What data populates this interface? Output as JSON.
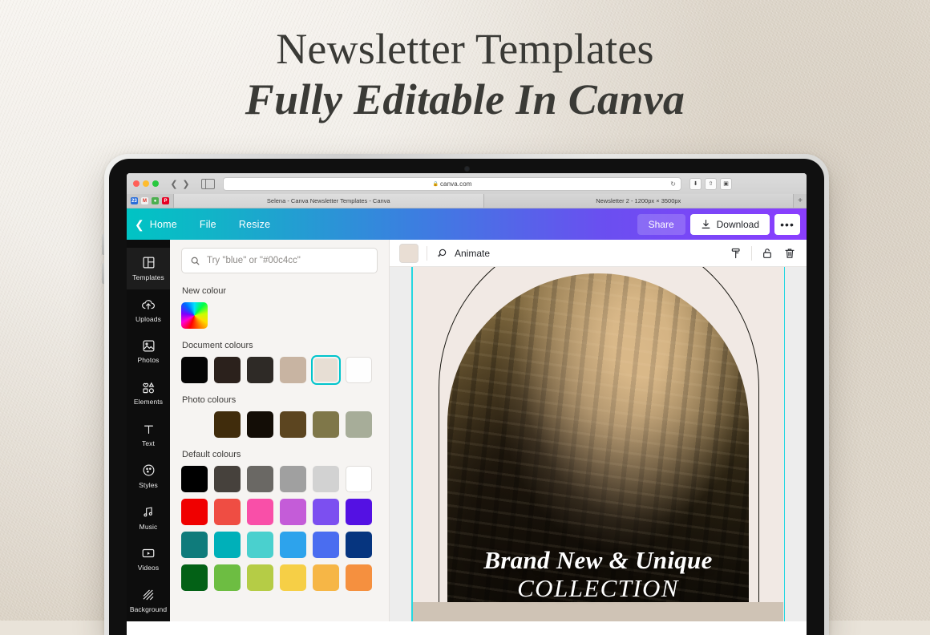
{
  "headline": {
    "line1": "Newsletter Templates",
    "line2": "Fully Editable In Canva"
  },
  "browser": {
    "url": "canva.com",
    "lock_icon": "lock-icon",
    "reload_icon": "reload-icon",
    "back_icon": "chevron-left-icon",
    "forward_icon": "chevron-right-icon",
    "sidebar_icon": "sidebar-toggle-icon",
    "traffic_lights": [
      "#ff5f57",
      "#febc2e",
      "#28c840"
    ],
    "toolbar_icons": [
      "downloads-icon",
      "share-icon",
      "tab-overview-icon"
    ],
    "bookmarks": [
      {
        "name": "bookmark-favicon-calendar",
        "glyph": "23",
        "color": "#2b6ed9"
      },
      {
        "name": "bookmark-favicon-gmail",
        "glyph": "M",
        "color": "#d93025"
      },
      {
        "name": "bookmark-favicon-leaf",
        "glyph": "●",
        "color": "#4caf50"
      },
      {
        "name": "bookmark-favicon-pinterest",
        "glyph": "P",
        "color": "#e60023"
      }
    ],
    "tabs": [
      {
        "title": "Selena - Canva Newsletter Templates - Canva",
        "active": true
      },
      {
        "title": "Newsletter 2 - 1200px × 3500px",
        "active": false
      }
    ],
    "new_tab_label": "+"
  },
  "canva_toolbar": {
    "back_icon": "chevron-left-icon",
    "home_label": "Home",
    "file_label": "File",
    "resize_label": "Resize",
    "share_label": "Share",
    "download_label": "Download",
    "download_icon": "download-icon",
    "more_label": "•••",
    "gradient_start": "#00c4c4",
    "gradient_end": "#8b3dff"
  },
  "rail": {
    "items": [
      {
        "label": "Templates",
        "icon": "templates-icon",
        "active": true
      },
      {
        "label": "Uploads",
        "icon": "upload-cloud-icon",
        "active": false
      },
      {
        "label": "Photos",
        "icon": "photo-icon",
        "active": false
      },
      {
        "label": "Elements",
        "icon": "elements-shapes-icon",
        "active": false
      },
      {
        "label": "Text",
        "icon": "text-icon",
        "active": false
      },
      {
        "label": "Styles",
        "icon": "styles-palette-icon",
        "active": false
      },
      {
        "label": "Music",
        "icon": "music-note-icon",
        "active": false
      },
      {
        "label": "Videos",
        "icon": "video-play-icon",
        "active": false
      },
      {
        "label": "Background",
        "icon": "background-hatch-icon",
        "active": false
      }
    ]
  },
  "panel": {
    "search_placeholder": "Try \"blue\" or \"#00c4cc\"",
    "search_icon": "search-icon",
    "new_colour": {
      "title": "New colour",
      "picker_name": "rainbow-colour-picker"
    },
    "document_colours": {
      "title": "Document colours",
      "selected_index": 4,
      "selection_ring": "#00c4cc",
      "swatches": [
        "#050505",
        "#2b211c",
        "#2e2a26",
        "#c8b4a2",
        "#e7ded4",
        "#fefefe"
      ]
    },
    "photo_colours": {
      "title": "Photo colours",
      "thumbnail_name": "photo-thumbnail",
      "swatches": [
        "#402c0c",
        "#130d06",
        "#5c4520",
        "#7f7749",
        "#a7ad99"
      ]
    },
    "default_colours": {
      "title": "Default colours",
      "swatches": [
        "#000000",
        "#46413c",
        "#6a6864",
        "#a0a0a0",
        "#d2d2d2",
        "#ffffff",
        "#f00000",
        "#ef4d43",
        "#f94fa8",
        "#c45cd8",
        "#7c4ff0",
        "#5411e3",
        "#0f7b7b",
        "#00b0b9",
        "#4ad0ce",
        "#2da3ec",
        "#4a6df0",
        "#06357f",
        "#036116",
        "#6dbd42",
        "#b5cc46",
        "#f6cf46",
        "#f6b646",
        "#f5903f"
      ]
    }
  },
  "canvas_toolbar": {
    "fill_swatch": "#e9ded4",
    "animate_label": "Animate",
    "animate_icon": "animate-icon",
    "copy_style_icon": "paint-roller-icon",
    "lock_icon": "lock-open-icon",
    "delete_icon": "trash-icon"
  },
  "artwork": {
    "page_background": "#f1e9e4",
    "guide_color": "#25d7e0",
    "title_line1": "Brand New & Unique",
    "title_line2": "COLLECTION",
    "arch_shape": "arch-outline",
    "photo_name": "woman-hanging-jewelry-photo"
  }
}
